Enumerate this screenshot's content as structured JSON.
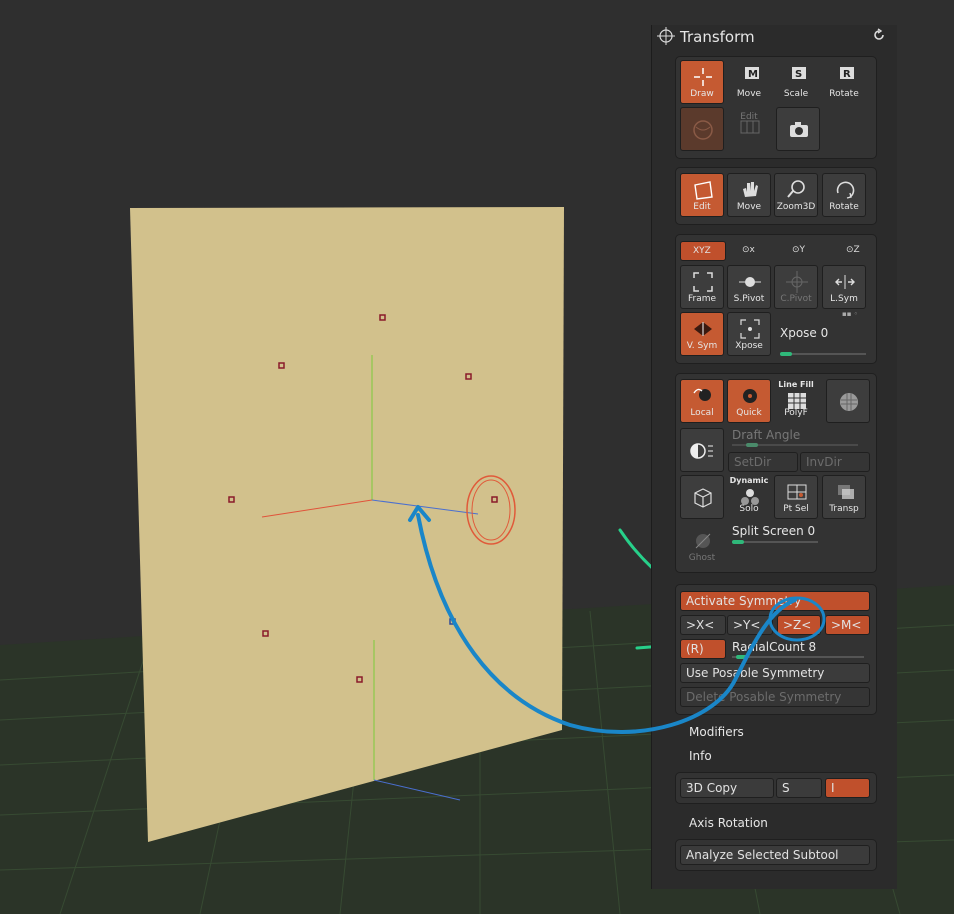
{
  "panel": {
    "title": "Transform",
    "colors": {
      "accent": "#c55a32",
      "panel_bg": "#2b2b2b",
      "slider": "#2fb87a"
    },
    "tools": [
      {
        "label": "Draw",
        "icon": "draw-icon"
      },
      {
        "label": "Move",
        "icon": "move-icon"
      },
      {
        "label": "Scale",
        "icon": "scale-icon"
      },
      {
        "label": "Rotate",
        "icon": "rotate-icon"
      },
      {
        "label": "Edit",
        "icon": "edit-icon"
      }
    ],
    "camera": {
      "edit": "Edit",
      "move": "Move",
      "zoom": "Zoom3D",
      "rotate": "Rotate"
    },
    "pivot": {
      "xyz": "XYZ",
      "y_label": "Y",
      "z_label": "Z",
      "frame": "Frame",
      "spivot": "S.Pivot",
      "cpivot": "C.Pivot",
      "lsym": "L.Sym",
      "vsym": "V. Sym",
      "xpose": "Xpose",
      "xpose_value": "Xpose 0",
      "xpose_level": 0
    },
    "display": {
      "local": "Local",
      "quick": "Quick",
      "line_fill": "Line Fill",
      "polyf": "PolyF",
      "draft_angle": "Draft Angle",
      "setdir": "SetDir",
      "invdir": "InvDir",
      "dynamic": "Dynamic",
      "solo": "Solo",
      "ptsel": "Pt Sel",
      "transp": "Transp",
      "ghost": "Ghost",
      "split_screen": "Split Screen 0"
    },
    "symmetry": {
      "activate": "Activate Symmetry",
      "x": ">X<",
      "y": ">Y<",
      "z": ">Z<",
      "m": ">M<",
      "r": "(R)",
      "radial_count": "RadialCount 8",
      "use_posable": "Use Posable Symmetry",
      "delete_posable": "Delete Posable Symmetry"
    },
    "modifiers": "Modifiers",
    "info": "Info",
    "copy": {
      "label": "3D Copy",
      "s": "S",
      "i": "I"
    },
    "axis_rotation": "Axis Rotation",
    "analyze": "Analyze Selected Subtool"
  }
}
